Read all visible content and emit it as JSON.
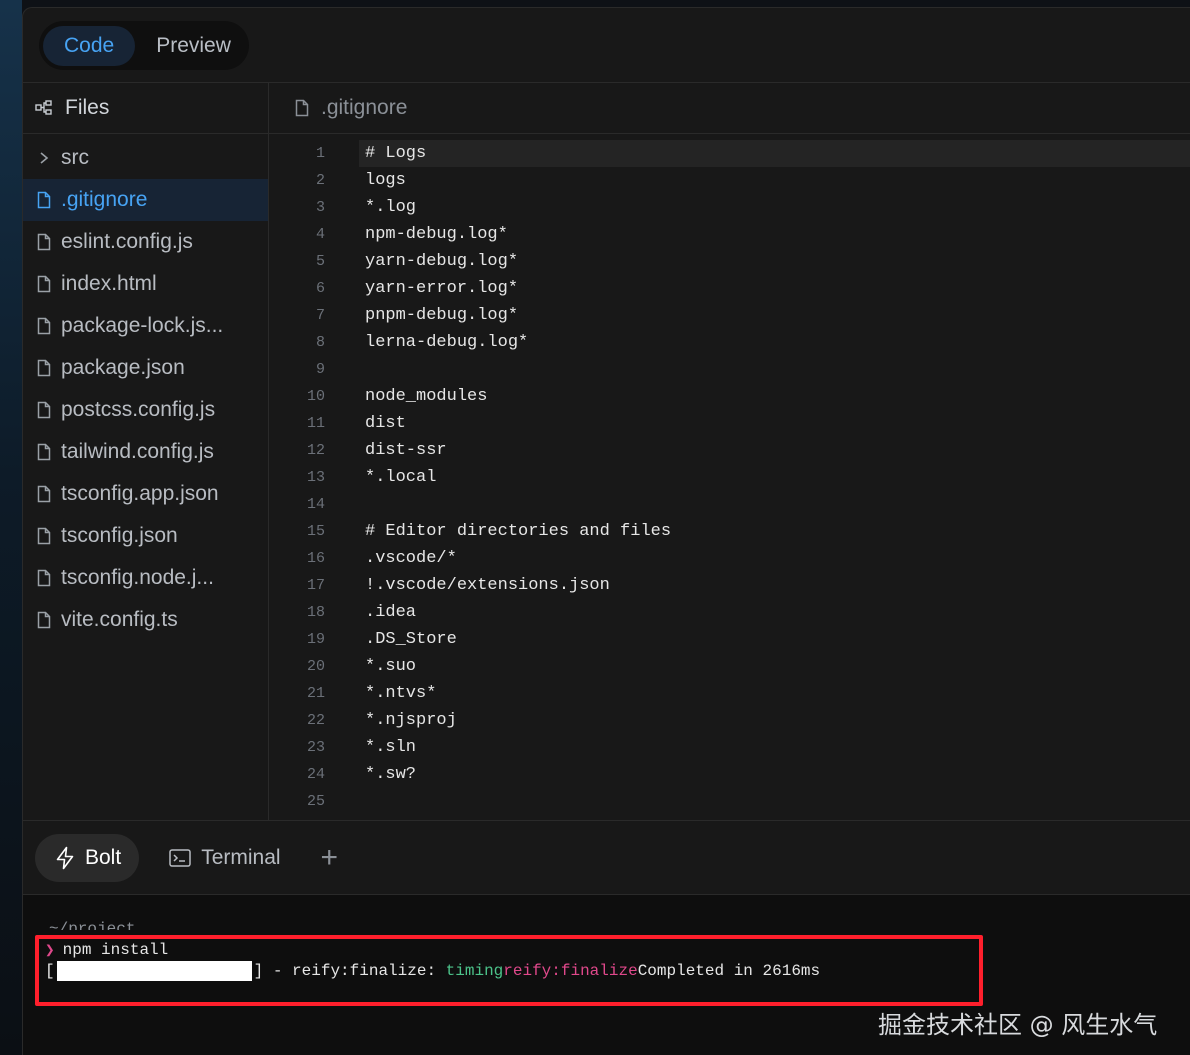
{
  "header": {
    "tabs": [
      {
        "label": "Code",
        "active": true
      },
      {
        "label": "Preview",
        "active": false
      }
    ]
  },
  "sidebar": {
    "title": "Files",
    "items": [
      {
        "label": "src",
        "type": "folder"
      },
      {
        "label": ".gitignore",
        "type": "file",
        "selected": true
      },
      {
        "label": "eslint.config.js",
        "type": "file"
      },
      {
        "label": "index.html",
        "type": "file"
      },
      {
        "label": "package-lock.js...",
        "type": "file"
      },
      {
        "label": "package.json",
        "type": "file"
      },
      {
        "label": "postcss.config.js",
        "type": "file"
      },
      {
        "label": "tailwind.config.js",
        "type": "file"
      },
      {
        "label": "tsconfig.app.json",
        "type": "file"
      },
      {
        "label": "tsconfig.json",
        "type": "file"
      },
      {
        "label": "tsconfig.node.j...",
        "type": "file"
      },
      {
        "label": "vite.config.ts",
        "type": "file"
      }
    ]
  },
  "editor": {
    "filename": ".gitignore",
    "lines": [
      {
        "n": "1",
        "text": "# Logs"
      },
      {
        "n": "2",
        "text": "logs"
      },
      {
        "n": "3",
        "text": "*.log"
      },
      {
        "n": "4",
        "text": "npm-debug.log*"
      },
      {
        "n": "5",
        "text": "yarn-debug.log*"
      },
      {
        "n": "6",
        "text": "yarn-error.log*"
      },
      {
        "n": "7",
        "text": "pnpm-debug.log*"
      },
      {
        "n": "8",
        "text": "lerna-debug.log*"
      },
      {
        "n": "9",
        "text": ""
      },
      {
        "n": "10",
        "text": "node_modules"
      },
      {
        "n": "11",
        "text": "dist"
      },
      {
        "n": "12",
        "text": "dist-ssr"
      },
      {
        "n": "13",
        "text": "*.local"
      },
      {
        "n": "14",
        "text": ""
      },
      {
        "n": "15",
        "text": "# Editor directories and files"
      },
      {
        "n": "16",
        "text": ".vscode/*"
      },
      {
        "n": "17",
        "text": "!.vscode/extensions.json"
      },
      {
        "n": "18",
        "text": ".idea"
      },
      {
        "n": "19",
        "text": ".DS_Store"
      },
      {
        "n": "20",
        "text": "*.suo"
      },
      {
        "n": "21",
        "text": "*.ntvs*"
      },
      {
        "n": "22",
        "text": "*.njsproj"
      },
      {
        "n": "23",
        "text": "*.sln"
      },
      {
        "n": "24",
        "text": "*.sw?"
      },
      {
        "n": "25",
        "text": ""
      }
    ]
  },
  "panel": {
    "tabs": [
      {
        "label": "Bolt",
        "active": true
      },
      {
        "label": "Terminal",
        "active": false
      }
    ],
    "add_label": "+"
  },
  "terminal": {
    "path": "~/project",
    "prompt_symbol": "❯",
    "command": "npm install",
    "bracket_open": "[",
    "bracket_close": "]",
    "dash": " - ",
    "stage": "reify:finalize: ",
    "timing": "timing",
    "stage2": "reify:finalize",
    "completed": "Completed in 2616ms"
  },
  "watermark": "掘金技术社区 @ 风生水气",
  "colors": {
    "accent": "#47a3f3",
    "highlight": "#ff1f2c",
    "pink": "#e0488b",
    "green": "#4cc38a"
  }
}
